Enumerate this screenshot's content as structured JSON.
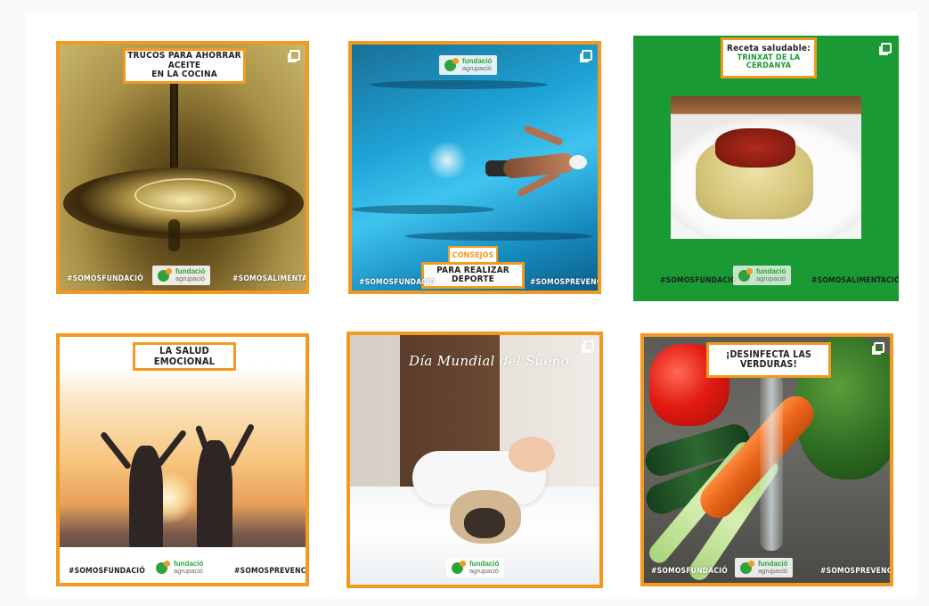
{
  "posts": [
    {
      "id": "oil",
      "title_lines": [
        "TRUCOS PARA AHORRAR ACEITE",
        "EN LA COCINA"
      ],
      "tag_left": "#SOMOSFUNDACIÓ",
      "tag_right": "#SOMOSALIMENTACIÓN",
      "logo": {
        "line1": "fundació",
        "line2": "agrupació"
      }
    },
    {
      "id": "swim",
      "subtitle": "CONSEJOS",
      "title_lines": [
        "PARA REALIZAR DEPORTE"
      ],
      "tag_left": "#SOMOSFUNDACIÓ",
      "tag_right": "#SOMOSPREVENCIÓN",
      "logo": {
        "line1": "fundació",
        "line2": "agrupació"
      }
    },
    {
      "id": "recipe",
      "title_lines": [
        "Receta saludable:",
        "TRINXAT DE LA CERDANYA"
      ],
      "tag_left": "#SOMOSFUNDACIÓ",
      "tag_right": "#SOMOSALIMENTACIÓN",
      "logo": {
        "line1": "fundació",
        "line2": "agrupació"
      }
    },
    {
      "id": "emo",
      "title_lines": [
        "LA SALUD EMOCIONAL"
      ],
      "tag_left": "#SOMOSFUNDACIÓ",
      "tag_right": "#SOMOSPREVENCIÓN",
      "logo": {
        "line1": "fundació",
        "line2": "agrupació"
      }
    },
    {
      "id": "sleep",
      "script_title": "Día Mundial del Sueño",
      "logo": {
        "line1": "fundació",
        "line2": "agrupació"
      }
    },
    {
      "id": "veg",
      "title_lines": [
        "¡DESINFECTA LAS VERDURAS!"
      ],
      "tag_left": "#SOMOSFUNDACIÓ",
      "tag_right": "#SOMOSPREVENCIÓN",
      "logo": {
        "line1": "fundació",
        "line2": "agrupació"
      }
    }
  ],
  "colors": {
    "brand_orange": "#f29a1f",
    "brand_green": "#2da33a",
    "recipe_bg": "#1a9a34"
  },
  "icons": {
    "carousel": "carousel-icon"
  }
}
